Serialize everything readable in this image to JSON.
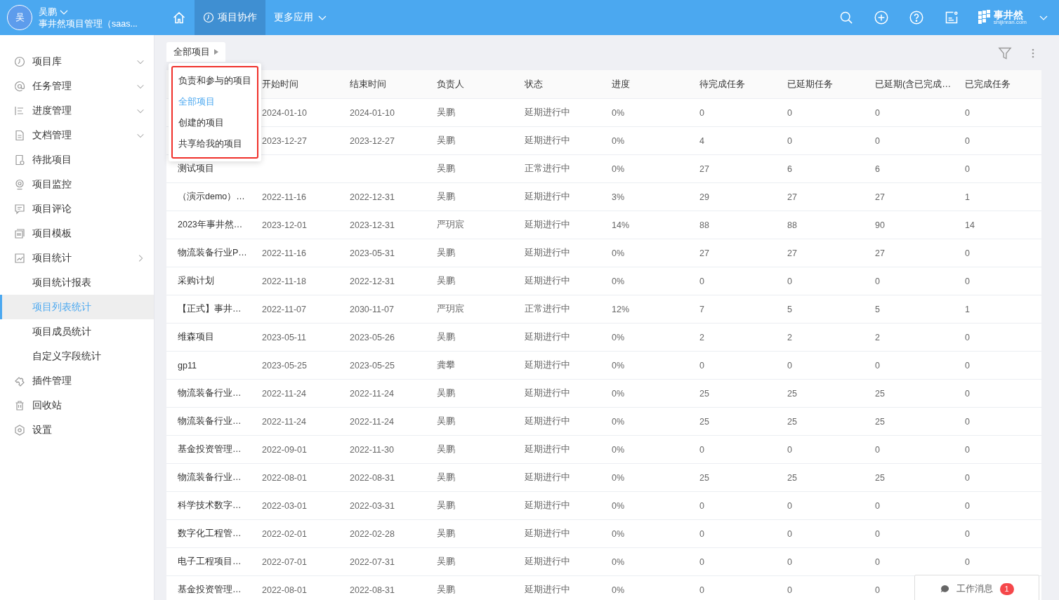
{
  "topbar": {
    "avatar": "吴",
    "user_name": "吴鹏",
    "org": "事井然项目管理（saas...",
    "nav": [
      {
        "kind": "home",
        "selected": false
      },
      {
        "kind": "tab",
        "label": "项目协作",
        "selected": true
      },
      {
        "kind": "menu",
        "label": "更多应用",
        "selected": false
      }
    ],
    "logo": {
      "name": "事井然",
      "site": "shijinran.com"
    }
  },
  "sidebar": {
    "items": [
      {
        "kind": "group",
        "label": "项目库",
        "expanded": false,
        "selected": false
      },
      {
        "kind": "group",
        "label": "任务管理",
        "expanded": false,
        "selected": false
      },
      {
        "kind": "group",
        "label": "进度管理",
        "expanded": false,
        "selected": false
      },
      {
        "kind": "group",
        "label": "文档管理",
        "expanded": false,
        "selected": false
      },
      {
        "kind": "link",
        "label": "待批项目",
        "selected": false
      },
      {
        "kind": "link",
        "label": "项目监控",
        "selected": false
      },
      {
        "kind": "link",
        "label": "项目评论",
        "selected": false
      },
      {
        "kind": "link",
        "label": "项目模板",
        "selected": false
      },
      {
        "kind": "group",
        "label": "项目统计",
        "expanded": true,
        "selected": false,
        "children": [
          {
            "label": "项目统计报表",
            "selected": false
          },
          {
            "label": "项目列表统计",
            "selected": true
          },
          {
            "label": "项目成员统计",
            "selected": false
          },
          {
            "label": "自定义字段统计",
            "selected": false
          }
        ]
      },
      {
        "kind": "link",
        "label": "插件管理",
        "selected": false
      },
      {
        "kind": "link",
        "label": "回收站",
        "selected": false
      },
      {
        "kind": "link",
        "label": "设置",
        "selected": false
      }
    ]
  },
  "scope_tab": {
    "label": "全部项目"
  },
  "scope_menu": [
    {
      "label": "负责和参与的项目",
      "selected": false
    },
    {
      "label": "全部项目",
      "selected": true
    },
    {
      "label": "创建的项目",
      "selected": false
    },
    {
      "label": "共享给我的项目",
      "selected": false
    }
  ],
  "table": {
    "columns": [
      "开始时间",
      "结束时间",
      "负责人",
      "状态",
      "进度",
      "待完成任务",
      "已延期任务",
      "已延期(含已完成…",
      "已完成任务"
    ],
    "rows": [
      {
        "cells": [
          "2024-01-10",
          "2024-01-10",
          "吴鹏",
          "延期进行中",
          "0%",
          "0",
          "0",
          "0",
          "0"
        ]
      },
      {
        "cells": [
          "2023-12-27",
          "2023-12-27",
          "吴鹏",
          "延期进行中",
          "0%",
          "4",
          "0",
          "0",
          "0"
        ]
      },
      {
        "name": "测试项目",
        "cells": [
          null,
          null,
          "吴鹏",
          "正常进行中",
          "0%",
          "27",
          "6",
          "6",
          "0"
        ]
      },
      {
        "name": "（演示demo）…",
        "cells": [
          "2022-11-16",
          "2022-12-31",
          "吴鹏",
          "延期进行中",
          "3%",
          "29",
          "27",
          "27",
          "1"
        ]
      },
      {
        "name": "2023年事井然…",
        "cells": [
          "2023-12-01",
          "2023-12-31",
          "严玥宸",
          "延期进行中",
          "14%",
          "88",
          "88",
          "90",
          "14"
        ]
      },
      {
        "name": "物流装备行业P…",
        "cells": [
          "2022-11-16",
          "2023-05-31",
          "吴鹏",
          "延期进行中",
          "0%",
          "27",
          "27",
          "27",
          "0"
        ]
      },
      {
        "name": "采购计划",
        "cells": [
          "2022-11-18",
          "2022-12-31",
          "吴鹏",
          "延期进行中",
          "0%",
          "0",
          "0",
          "0",
          "0"
        ]
      },
      {
        "name": "【正式】事井…",
        "cells": [
          "2022-11-07",
          "2030-11-07",
          "严玥宸",
          "正常进行中",
          "12%",
          "7",
          "5",
          "5",
          "1"
        ]
      },
      {
        "name": "维森项目",
        "cells": [
          "2023-05-11",
          "2023-05-26",
          "吴鹏",
          "延期进行中",
          "0%",
          "2",
          "2",
          "2",
          "0"
        ]
      },
      {
        "name": "gp11",
        "cells": [
          "2023-05-25",
          "2023-05-25",
          "龚攀",
          "延期进行中",
          "0%",
          "0",
          "0",
          "0",
          "0"
        ]
      },
      {
        "name": "物流装备行业…",
        "cells": [
          "2022-11-24",
          "2022-11-24",
          "吴鹏",
          "延期进行中",
          "0%",
          "25",
          "25",
          "25",
          "0"
        ]
      },
      {
        "name": "物流装备行业…",
        "cells": [
          "2022-11-24",
          "2022-11-24",
          "吴鹏",
          "延期进行中",
          "0%",
          "25",
          "25",
          "25",
          "0"
        ]
      },
      {
        "name": "基金投资管理…",
        "cells": [
          "2022-09-01",
          "2022-11-30",
          "吴鹏",
          "延期进行中",
          "0%",
          "0",
          "0",
          "0",
          "0"
        ]
      },
      {
        "name": "物流装备行业…",
        "cells": [
          "2022-08-01",
          "2022-08-31",
          "吴鹏",
          "延期进行中",
          "0%",
          "25",
          "25",
          "25",
          "0"
        ]
      },
      {
        "name": "科学技术数字…",
        "cells": [
          "2022-03-01",
          "2022-03-31",
          "吴鹏",
          "延期进行中",
          "0%",
          "0",
          "0",
          "0",
          "0"
        ]
      },
      {
        "name": "数字化工程管…",
        "cells": [
          "2022-02-01",
          "2022-02-28",
          "吴鹏",
          "延期进行中",
          "0%",
          "0",
          "0",
          "0",
          "0"
        ]
      },
      {
        "name": "电子工程项目…",
        "cells": [
          "2022-07-01",
          "2022-07-31",
          "吴鹏",
          "延期进行中",
          "0%",
          "0",
          "0",
          "0",
          "0"
        ]
      },
      {
        "name": "基金投资管理…",
        "cells": [
          "2022-08-01",
          "2022-08-31",
          "吴鹏",
          "延期进行中",
          "0%",
          "0",
          "0",
          "0"
        ]
      }
    ]
  },
  "messages": {
    "label": "工作消息",
    "count": "1"
  }
}
